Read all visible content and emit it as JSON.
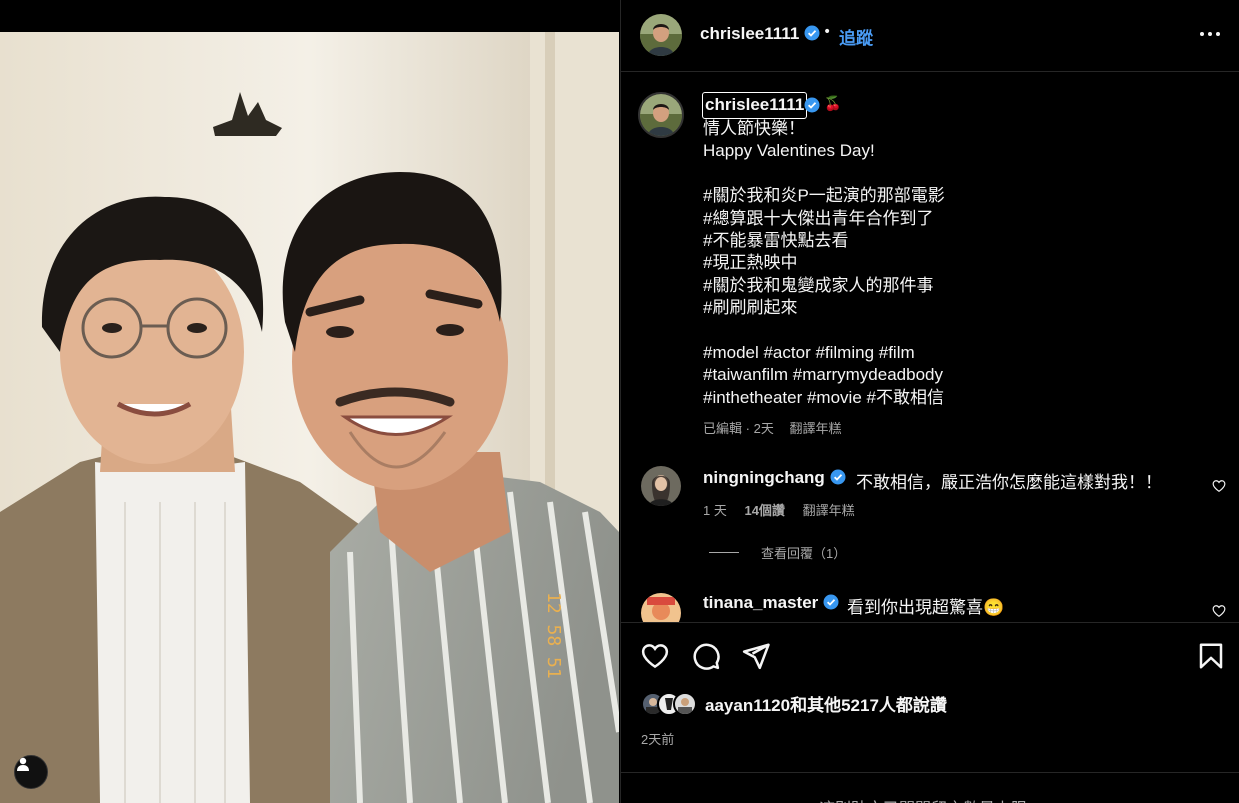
{
  "post": {
    "author": "chrislee1111",
    "follow_label": "追蹤",
    "separator": "•",
    "caption_emoji": "🍒",
    "caption": "情人節快樂！\nHappy Valentines Day!\n\n#關於我和炎P一起演的那部電影\n#總算跟十大傑出青年合作到了\n#不能暴雷快點去看\n#現正熱映中\n#關於我和鬼變成家人的那件事\n#刷刷刷起來\n\n#model #actor #filming #film\n#taiwanfilm #marrymydeadbody\n#inthetheater #movie #不敢相信",
    "caption_meta": {
      "edited": "已編輯",
      "dot": "·",
      "age": "2天",
      "translate": "翻譯年糕"
    }
  },
  "comments": [
    {
      "user": "ningningchang",
      "text": "不敢相信，嚴正浩你怎麼能這樣對我！！",
      "age": "1 天",
      "likes": "14個讚",
      "translate": "翻譯年糕",
      "view_replies": "查看回覆（1）"
    },
    {
      "user": "tinana_master",
      "text": "看到你出現超驚喜😁"
    }
  ],
  "engagement": {
    "likes_text": "aayan1120和其他5217人都說讚",
    "time": "2天前"
  },
  "footer": {
    "notice": "這則貼文已關閉留言數量上限"
  },
  "icons": {
    "verified": "verified-badge-icon",
    "more": "more-options-icon",
    "like": "heart-icon",
    "comment": "comment-icon",
    "share": "send-icon",
    "save": "bookmark-icon",
    "tag": "user-tag-icon"
  },
  "colors": {
    "background": "#000000",
    "accent": "#4a9cf5",
    "verified": "#3897f0",
    "muted_text": "#a8a8a8"
  }
}
